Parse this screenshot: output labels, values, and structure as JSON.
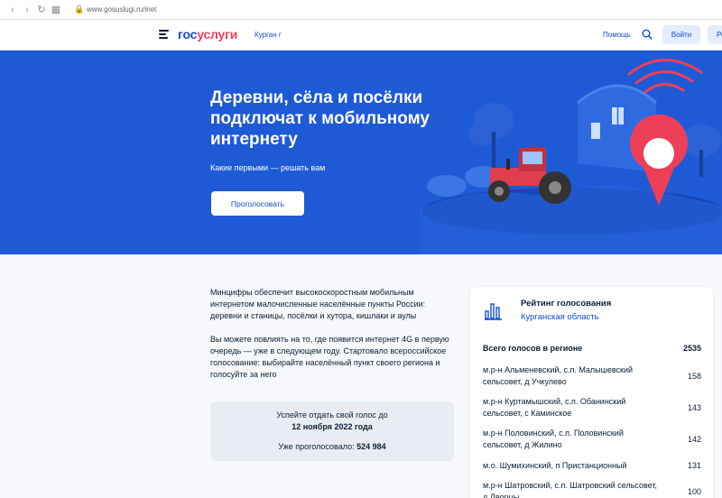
{
  "browser": {
    "url": "www.gosuslugi.ru/inet"
  },
  "header": {
    "logo_part1": "гос",
    "logo_part2": "услуги",
    "city": "Курган г",
    "help": "Помощь",
    "login": "Войти",
    "register": "Ре"
  },
  "hero": {
    "title": "Деревни, сёла и посёлки подключат к мобильному интернету",
    "subtitle": "Какие первыми — решать вам",
    "vote_button": "Проголосовать"
  },
  "content": {
    "intro": "Минцифры обеспечит высокоскоростным мобильным интернетом малочисленные населённые пункты России: деревни и станицы, посёлки и хутора, кишлаки и аулы",
    "info": "Вы можете повлиять на то, где появится интернет 4G в первую очередь — уже в следующем году. Стартовало всероссийское голосование: выбирайте населённый пункт своего региона и голосуйте за него",
    "deadline_text": "Успейте отдать свой голос до",
    "deadline_date": "12 ноября 2022 года",
    "voted_label": "Уже проголосовало:",
    "voted_count": "524 984"
  },
  "rating": {
    "title": "Рейтинг голосования",
    "region": "Курганская область",
    "total_label": "Всего голосов в регионе",
    "total_value": "2535",
    "rows": [
      {
        "name": "м.р-н Альменевский, с.п. Малышевский сельсовет, д Учкулево",
        "count": "158"
      },
      {
        "name": "м.р-н Куртамышский, с.п. Обанинский сельсовет, с Каминское",
        "count": "143"
      },
      {
        "name": "м.р-н Половинский, с.п. Половинский сельсовет, д Жилино",
        "count": "142"
      },
      {
        "name": "м.о. Шумихинский, п Пристанционный",
        "count": "131"
      },
      {
        "name": "м.р-н Шатровский, с.п. Шатровский сельсовет, д Дворцы",
        "count": "100"
      }
    ]
  },
  "colors": {
    "brand_blue": "#0d4cd3",
    "brand_red": "#ee3f58",
    "hero_bg": "#1e5ad6"
  }
}
